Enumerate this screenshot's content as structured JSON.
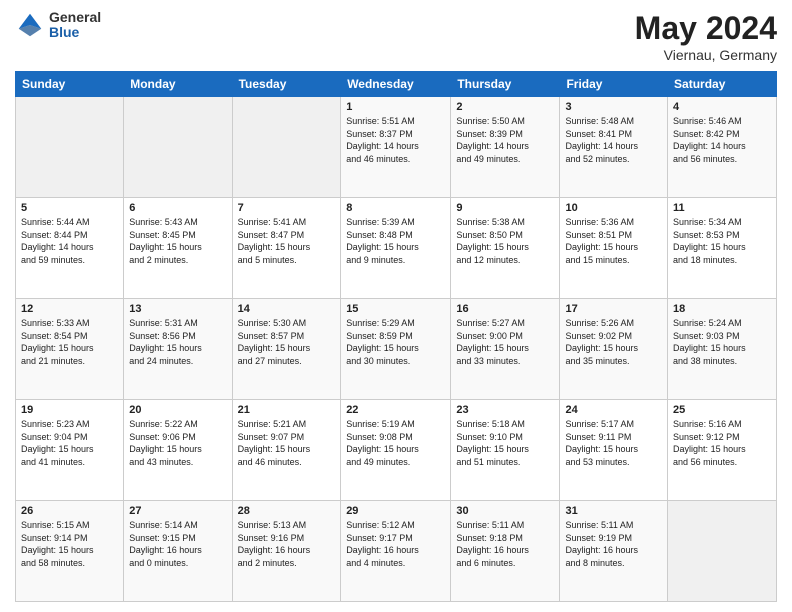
{
  "header": {
    "logo_general": "General",
    "logo_blue": "Blue",
    "title": "May 2024",
    "location": "Viernau, Germany"
  },
  "days_of_week": [
    "Sunday",
    "Monday",
    "Tuesday",
    "Wednesday",
    "Thursday",
    "Friday",
    "Saturday"
  ],
  "weeks": [
    [
      {
        "num": "",
        "info": ""
      },
      {
        "num": "",
        "info": ""
      },
      {
        "num": "",
        "info": ""
      },
      {
        "num": "1",
        "info": "Sunrise: 5:51 AM\nSunset: 8:37 PM\nDaylight: 14 hours\nand 46 minutes."
      },
      {
        "num": "2",
        "info": "Sunrise: 5:50 AM\nSunset: 8:39 PM\nDaylight: 14 hours\nand 49 minutes."
      },
      {
        "num": "3",
        "info": "Sunrise: 5:48 AM\nSunset: 8:41 PM\nDaylight: 14 hours\nand 52 minutes."
      },
      {
        "num": "4",
        "info": "Sunrise: 5:46 AM\nSunset: 8:42 PM\nDaylight: 14 hours\nand 56 minutes."
      }
    ],
    [
      {
        "num": "5",
        "info": "Sunrise: 5:44 AM\nSunset: 8:44 PM\nDaylight: 14 hours\nand 59 minutes."
      },
      {
        "num": "6",
        "info": "Sunrise: 5:43 AM\nSunset: 8:45 PM\nDaylight: 15 hours\nand 2 minutes."
      },
      {
        "num": "7",
        "info": "Sunrise: 5:41 AM\nSunset: 8:47 PM\nDaylight: 15 hours\nand 5 minutes."
      },
      {
        "num": "8",
        "info": "Sunrise: 5:39 AM\nSunset: 8:48 PM\nDaylight: 15 hours\nand 9 minutes."
      },
      {
        "num": "9",
        "info": "Sunrise: 5:38 AM\nSunset: 8:50 PM\nDaylight: 15 hours\nand 12 minutes."
      },
      {
        "num": "10",
        "info": "Sunrise: 5:36 AM\nSunset: 8:51 PM\nDaylight: 15 hours\nand 15 minutes."
      },
      {
        "num": "11",
        "info": "Sunrise: 5:34 AM\nSunset: 8:53 PM\nDaylight: 15 hours\nand 18 minutes."
      }
    ],
    [
      {
        "num": "12",
        "info": "Sunrise: 5:33 AM\nSunset: 8:54 PM\nDaylight: 15 hours\nand 21 minutes."
      },
      {
        "num": "13",
        "info": "Sunrise: 5:31 AM\nSunset: 8:56 PM\nDaylight: 15 hours\nand 24 minutes."
      },
      {
        "num": "14",
        "info": "Sunrise: 5:30 AM\nSunset: 8:57 PM\nDaylight: 15 hours\nand 27 minutes."
      },
      {
        "num": "15",
        "info": "Sunrise: 5:29 AM\nSunset: 8:59 PM\nDaylight: 15 hours\nand 30 minutes."
      },
      {
        "num": "16",
        "info": "Sunrise: 5:27 AM\nSunset: 9:00 PM\nDaylight: 15 hours\nand 33 minutes."
      },
      {
        "num": "17",
        "info": "Sunrise: 5:26 AM\nSunset: 9:02 PM\nDaylight: 15 hours\nand 35 minutes."
      },
      {
        "num": "18",
        "info": "Sunrise: 5:24 AM\nSunset: 9:03 PM\nDaylight: 15 hours\nand 38 minutes."
      }
    ],
    [
      {
        "num": "19",
        "info": "Sunrise: 5:23 AM\nSunset: 9:04 PM\nDaylight: 15 hours\nand 41 minutes."
      },
      {
        "num": "20",
        "info": "Sunrise: 5:22 AM\nSunset: 9:06 PM\nDaylight: 15 hours\nand 43 minutes."
      },
      {
        "num": "21",
        "info": "Sunrise: 5:21 AM\nSunset: 9:07 PM\nDaylight: 15 hours\nand 46 minutes."
      },
      {
        "num": "22",
        "info": "Sunrise: 5:19 AM\nSunset: 9:08 PM\nDaylight: 15 hours\nand 49 minutes."
      },
      {
        "num": "23",
        "info": "Sunrise: 5:18 AM\nSunset: 9:10 PM\nDaylight: 15 hours\nand 51 minutes."
      },
      {
        "num": "24",
        "info": "Sunrise: 5:17 AM\nSunset: 9:11 PM\nDaylight: 15 hours\nand 53 minutes."
      },
      {
        "num": "25",
        "info": "Sunrise: 5:16 AM\nSunset: 9:12 PM\nDaylight: 15 hours\nand 56 minutes."
      }
    ],
    [
      {
        "num": "26",
        "info": "Sunrise: 5:15 AM\nSunset: 9:14 PM\nDaylight: 15 hours\nand 58 minutes."
      },
      {
        "num": "27",
        "info": "Sunrise: 5:14 AM\nSunset: 9:15 PM\nDaylight: 16 hours\nand 0 minutes."
      },
      {
        "num": "28",
        "info": "Sunrise: 5:13 AM\nSunset: 9:16 PM\nDaylight: 16 hours\nand 2 minutes."
      },
      {
        "num": "29",
        "info": "Sunrise: 5:12 AM\nSunset: 9:17 PM\nDaylight: 16 hours\nand 4 minutes."
      },
      {
        "num": "30",
        "info": "Sunrise: 5:11 AM\nSunset: 9:18 PM\nDaylight: 16 hours\nand 6 minutes."
      },
      {
        "num": "31",
        "info": "Sunrise: 5:11 AM\nSunset: 9:19 PM\nDaylight: 16 hours\nand 8 minutes."
      },
      {
        "num": "",
        "info": ""
      }
    ]
  ]
}
